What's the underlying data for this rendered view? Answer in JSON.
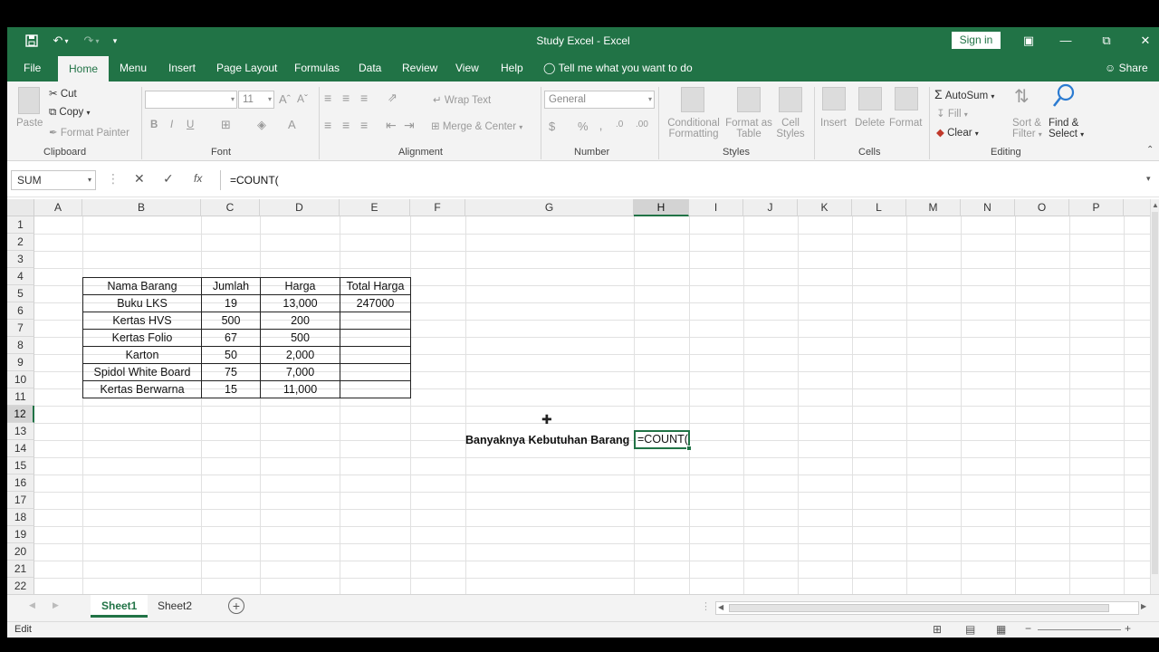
{
  "window": {
    "title": "Study Excel  -  Excel",
    "signin": "Sign in"
  },
  "tabs": [
    "File",
    "Home",
    "Menu",
    "Insert",
    "Page Layout",
    "Formulas",
    "Data",
    "Review",
    "View",
    "Help"
  ],
  "tell_me": "Tell me what you want to do",
  "share": "Share",
  "ribbon": {
    "clipboard": {
      "paste": "Paste",
      "cut": "Cut",
      "copy": "Copy",
      "format_painter": "Format Painter",
      "label": "Clipboard"
    },
    "font": {
      "size": "11",
      "label": "Font"
    },
    "alignment": {
      "wrap": "Wrap Text",
      "merge": "Merge & Center",
      "label": "Alignment"
    },
    "number": {
      "format": "General",
      "label": "Number"
    },
    "styles": {
      "cond": "Conditional",
      "cond2": "Formatting",
      "fmt_table": "Format as",
      "fmt_table2": "Table",
      "cell_styles": "Cell",
      "cell_styles2": "Styles",
      "label": "Styles"
    },
    "cells": {
      "insert": "Insert",
      "delete": "Delete",
      "format": "Format",
      "label": "Cells"
    },
    "editing": {
      "autosum": "AutoSum",
      "fill": "Fill",
      "clear": "Clear",
      "sort": "Sort &",
      "sort2": "Filter",
      "find": "Find &",
      "find2": "Select",
      "label": "Editing"
    }
  },
  "formula_bar": {
    "name_box": "SUM",
    "formula": "=COUNT("
  },
  "columns": [
    "A",
    "B",
    "C",
    "D",
    "E",
    "F",
    "G",
    "H",
    "I",
    "J",
    "K",
    "L",
    "M",
    "N",
    "O",
    "P"
  ],
  "rows": [
    "1",
    "2",
    "3",
    "4",
    "5",
    "6",
    "7",
    "8",
    "9",
    "10",
    "11",
    "12",
    "13",
    "14",
    "15",
    "16",
    "17",
    "18",
    "19",
    "20",
    "21",
    "22"
  ],
  "table": {
    "headers": [
      "Nama Barang",
      "Jumlah",
      "Harga",
      "Total Harga"
    ],
    "rows": [
      [
        "Buku LKS",
        "19",
        "13,000",
        "247000"
      ],
      [
        "Kertas HVS",
        "500",
        "200",
        ""
      ],
      [
        "Kertas Folio",
        "67",
        "500",
        ""
      ],
      [
        "Karton",
        "50",
        "2,000",
        ""
      ],
      [
        "Spidol White Board",
        "75",
        "7,000",
        ""
      ],
      [
        "Kertas Berwarna",
        "15",
        "11,000",
        ""
      ]
    ]
  },
  "label_cell": "Banyaknya Kebutuhan Barang :",
  "active_cell": "=COUNT(",
  "sheets": [
    "Sheet1",
    "Sheet2"
  ],
  "status": "Edit"
}
